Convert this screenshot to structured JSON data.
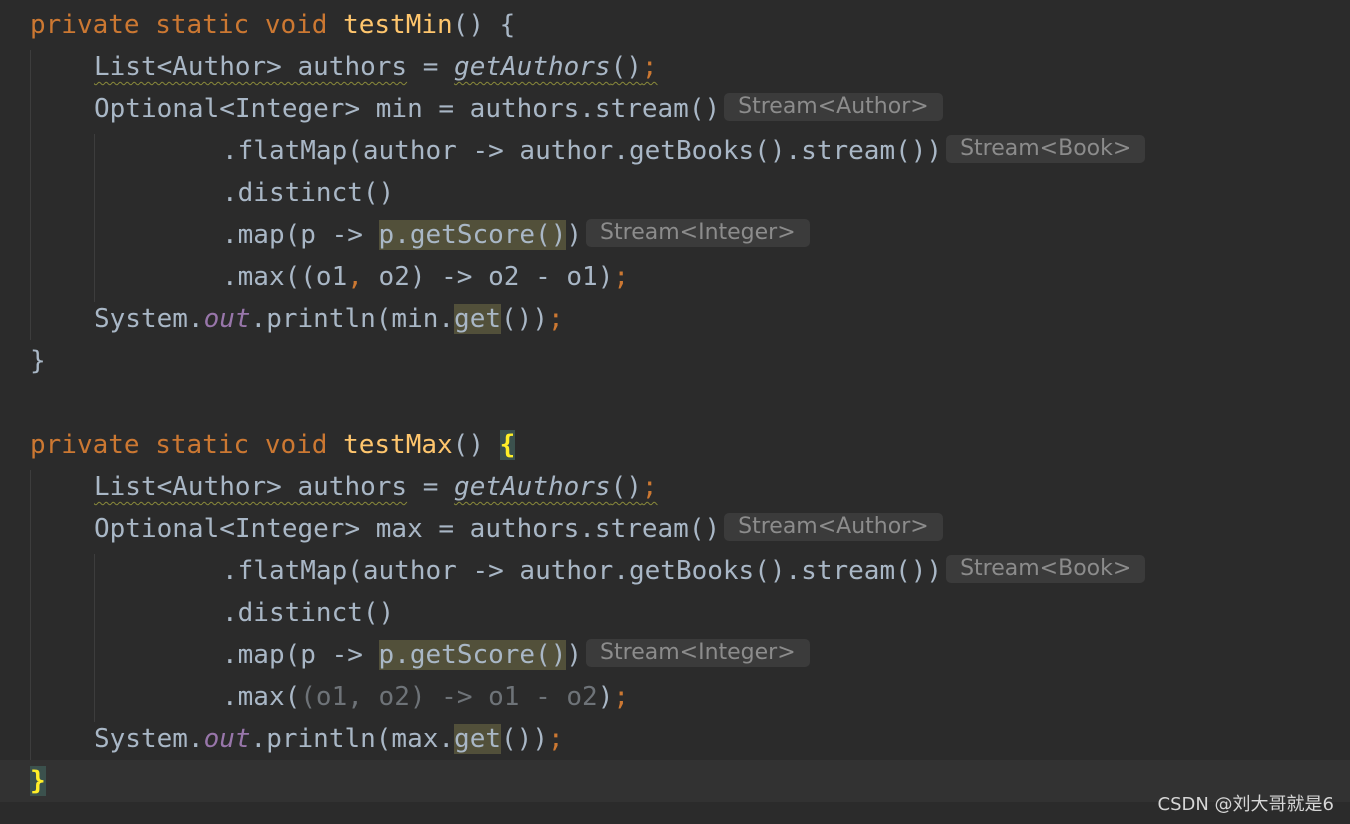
{
  "code": {
    "min": {
      "decl": {
        "mod1": "private",
        "mod2": "static",
        "ret": "void",
        "name": "testMin",
        "parens": "()",
        "brace": "{"
      },
      "l1": {
        "type": "List<Author> authors",
        "eq": " = ",
        "call": "getAuthors",
        "parens": "()",
        "semi": ";"
      },
      "l2": {
        "type": "Optional<Integer>",
        "rest": " min = authors.stream()",
        "hint": "Stream<Author>"
      },
      "l3": {
        "code": ".flatMap(author -> author.getBooks().stream())",
        "hint": "Stream<Book>"
      },
      "l4": {
        "code": ".distinct()"
      },
      "l5": {
        "pre": ".map(p -> ",
        "hl": "p.getScore()",
        "post": ")",
        "hint": "Stream<Integer>"
      },
      "l6": {
        "pre": ".max((o1",
        "comma": ",",
        "mid": " o2) -> o2 - o1)",
        "semi": ";"
      },
      "l7": {
        "pre": "System.",
        "field": "out",
        "mid": ".println(min.",
        "hl": "get",
        "post": "())",
        "semi": ";"
      },
      "close": "}"
    },
    "max": {
      "decl": {
        "mod1": "private",
        "mod2": "static",
        "ret": "void",
        "name": "testMax",
        "parens": "()",
        "brace": "{"
      },
      "l1": {
        "type": "List<Author> authors",
        "eq": " = ",
        "call": "getAuthors",
        "parens": "()",
        "semi": ";"
      },
      "l2": {
        "type": "Optional<Integer>",
        "rest": " max = authors.stream()",
        "hint": "Stream<Author>"
      },
      "l3": {
        "code": ".flatMap(author -> author.getBooks().stream())",
        "hint": "Stream<Book>"
      },
      "l4": {
        "code": ".distinct()"
      },
      "l5": {
        "pre": ".map(p -> ",
        "hl": "p.getScore()",
        "post": ")",
        "hint": "Stream<Integer>"
      },
      "l6": {
        "pre": ".max(",
        "dim": "(o1, o2) -> o1 - o2",
        "post": ")",
        "semi": ";"
      },
      "l7": {
        "pre": "System.",
        "field": "out",
        "mid": ".println(max.",
        "hl": "get",
        "post": "())",
        "semi": ";"
      },
      "close": "}"
    }
  },
  "watermark": "CSDN @刘大哥就是6",
  "colors": {
    "background": "#2b2b2b",
    "current_line": "#323232",
    "keyword": "#cc7832",
    "method_declaration": "#ffc66d",
    "default_text": "#a9b7c6",
    "static_field": "#9876aa",
    "usage_highlight": "#52503a",
    "brace_match": "#3b514d",
    "inlay_hint_bg": "#3b3b3b",
    "inlay_hint_text": "#8c8c8c"
  }
}
